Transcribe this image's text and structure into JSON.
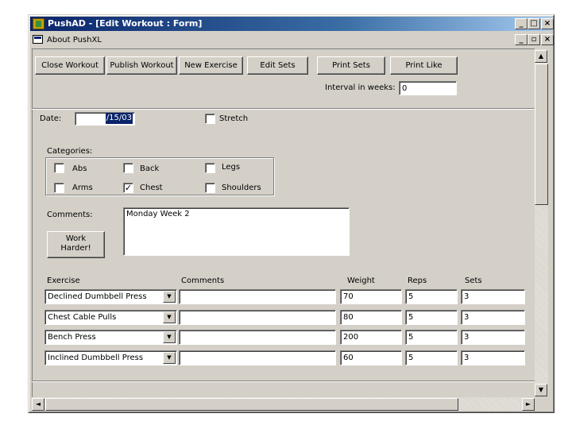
{
  "window": {
    "title": "PushAD - [Edit Workout : Form]"
  },
  "menubar": {
    "about": "About PushXL"
  },
  "toolbar": {
    "close_workout": "Close Workout",
    "publish_workout": "Publish Workout",
    "new_exercise": "New Exercise",
    "edit_sets": "Edit Sets",
    "print_sets": "Print Sets",
    "print_like": "Print Like",
    "interval_label": "Interval in weeks:",
    "interval_value": "0"
  },
  "form": {
    "date_label": "Date:",
    "date_value": "/15/03",
    "stretch_label": "Stretch",
    "stretch_checked": false,
    "categories_label": "Categories:",
    "categories": [
      {
        "label": "Abs",
        "checked": false
      },
      {
        "label": "Back",
        "checked": false
      },
      {
        "label": "Legs",
        "checked": false
      },
      {
        "label": "Arms",
        "checked": false
      },
      {
        "label": "Chest",
        "checked": true
      },
      {
        "label": "Shoulders",
        "checked": false
      }
    ],
    "comments_label": "Comments:",
    "comments_value": "Monday Week 2",
    "work_harder_line1": "Work",
    "work_harder_line2": "Harder!"
  },
  "table": {
    "headers": {
      "exercise": "Exercise",
      "comments": "Comments",
      "weight": "Weight",
      "reps": "Reps",
      "sets": "Sets"
    },
    "rows": [
      {
        "exercise": "Declined Dumbbell Press",
        "comments": "",
        "weight": "70",
        "reps": "5",
        "sets": "3"
      },
      {
        "exercise": "Chest Cable Pulls",
        "comments": "",
        "weight": "80",
        "reps": "5",
        "sets": "3"
      },
      {
        "exercise": "Bench Press",
        "comments": "",
        "weight": "200",
        "reps": "5",
        "sets": "3"
      },
      {
        "exercise": "Inclined Dumbbell Press",
        "comments": "",
        "weight": "60",
        "reps": "5",
        "sets": "3"
      }
    ]
  },
  "icons": {
    "app_icon": "push-app-icon",
    "doc_icon": "form-document-icon"
  },
  "colors": {
    "title_active": "#0a246a",
    "face": "#d4d0c8"
  }
}
